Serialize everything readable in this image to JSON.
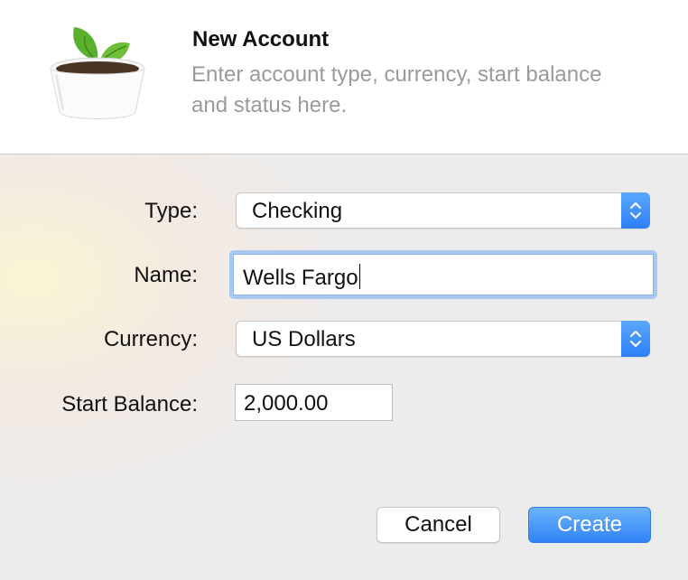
{
  "header": {
    "title": "New Account",
    "subtitle": "Enter account type, currency, start balance and status here."
  },
  "form": {
    "type_label": "Type:",
    "type_value": "Checking",
    "name_label": "Name:",
    "name_value": "Wells Fargo",
    "currency_label": "Currency:",
    "currency_value": "US Dollars",
    "start_balance_label": "Start Balance:",
    "start_balance_value": "2,000.00"
  },
  "buttons": {
    "cancel_label": "Cancel",
    "create_label": "Create"
  },
  "icons": {
    "app": "plant-pot-icon",
    "popup_arrows": "up-down-chevron-icon"
  },
  "colors": {
    "accent": "#2f84f7",
    "focus_ring": "#a9c8ef"
  }
}
